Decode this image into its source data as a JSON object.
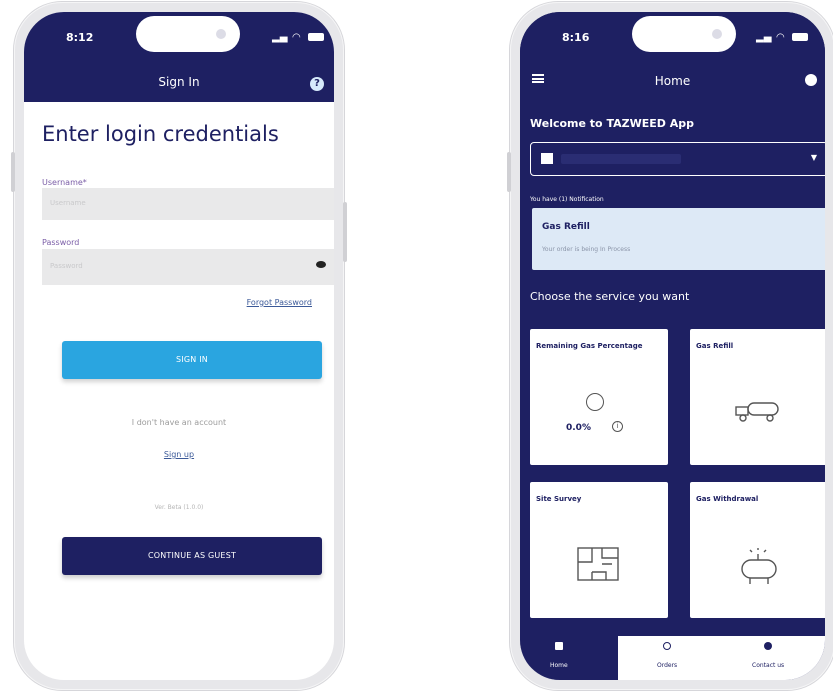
{
  "left_phone": {
    "status": {
      "time": "8:12"
    },
    "app_bar": {
      "title": "Sign In",
      "help_icon": "help-icon"
    },
    "heading": "Enter login credentials",
    "username": {
      "label": "Username*",
      "placeholder": "Username"
    },
    "password": {
      "label": "Password",
      "placeholder": "Password",
      "toggle_icon": "eye-icon"
    },
    "forgot_password": "Forgot Password",
    "sign_in_button": "SIGN IN",
    "no_account_text": "I don't have an account",
    "sign_up_link": "Sign up",
    "version_text": "Ver. Beta (1.0.0)",
    "guest_button": "CONTINUE AS GUEST",
    "colors": {
      "primary": "#1e2062",
      "accent": "#2aa5e0",
      "link": "#3b5998"
    }
  },
  "right_phone": {
    "status": {
      "time": "8:16"
    },
    "app_bar": {
      "title": "Home",
      "menu_icon": "menu-icon",
      "account_icon": "account-icon"
    },
    "welcome": "Welcome to TAZWEED App",
    "notification_count_text": "You have (1) Notification",
    "notification": {
      "title": "Gas Refill",
      "message": "Your order            is being In Process"
    },
    "choose_text": "Choose the service you want",
    "tiles": [
      {
        "label": "Remaining Gas Percentage",
        "value": "0.0%",
        "icon": "gauge-icon"
      },
      {
        "label": "Gas Refill",
        "icon": "truck-icon"
      },
      {
        "label": "Site Survey",
        "icon": "map-icon"
      },
      {
        "label": "Gas Withdrawal",
        "icon": "tank-icon"
      }
    ],
    "bottom_nav": [
      {
        "label": "Home",
        "icon": "home-icon"
      },
      {
        "label": "Orders",
        "icon": "orders-icon"
      },
      {
        "label": "Contact us",
        "icon": "contact-icon"
      }
    ]
  }
}
